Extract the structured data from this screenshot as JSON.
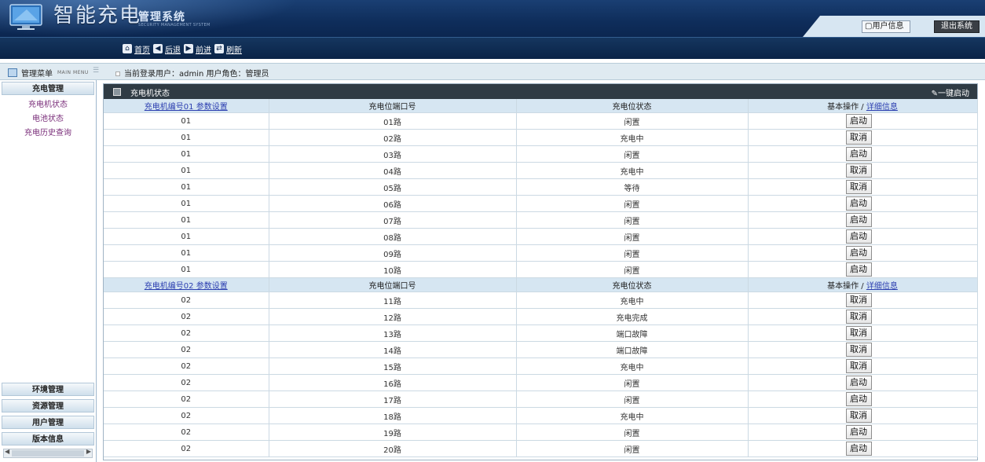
{
  "header": {
    "title": "智能充电",
    "subtitle": "管理系统",
    "subtitle_en": "SECURITY MANAGEMENT SYSTEM",
    "user_info_label": "用户信息",
    "logout_label": "退出系统"
  },
  "nav": {
    "home": "首页",
    "back": "后退",
    "forward": "前进",
    "refresh": "刷新"
  },
  "info_bar": {
    "menu_title": "管理菜单",
    "menu_title_en": "MAIN MENU",
    "login_text": "当前登录用户：admin  用户角色：管理员"
  },
  "sidebar": {
    "group_top": "充电管理",
    "items": [
      "充电机状态",
      "电池状态",
      "充电历史查询"
    ],
    "groups_bottom": [
      "环境管理",
      "资源管理",
      "用户管理",
      "版本信息"
    ]
  },
  "panel": {
    "title": "充电机状态",
    "one_click": "一键启动"
  },
  "table": {
    "col_port": "充电位端口号",
    "col_status": "充电位状态",
    "col_op_prefix": "基本操作 / ",
    "col_op_link": "详细信息",
    "groups": [
      {
        "header": "充电机编号01 参数设置",
        "rows": [
          {
            "machine": "01",
            "port": "01路",
            "status": "闲置",
            "action": "启动"
          },
          {
            "machine": "01",
            "port": "02路",
            "status": "充电中",
            "action": "取消"
          },
          {
            "machine": "01",
            "port": "03路",
            "status": "闲置",
            "action": "启动"
          },
          {
            "machine": "01",
            "port": "04路",
            "status": "充电中",
            "action": "取消"
          },
          {
            "machine": "01",
            "port": "05路",
            "status": "等待",
            "action": "取消"
          },
          {
            "machine": "01",
            "port": "06路",
            "status": "闲置",
            "action": "启动"
          },
          {
            "machine": "01",
            "port": "07路",
            "status": "闲置",
            "action": "启动"
          },
          {
            "machine": "01",
            "port": "08路",
            "status": "闲置",
            "action": "启动"
          },
          {
            "machine": "01",
            "port": "09路",
            "status": "闲置",
            "action": "启动"
          },
          {
            "machine": "01",
            "port": "10路",
            "status": "闲置",
            "action": "启动"
          }
        ]
      },
      {
        "header": "充电机编号02 参数设置",
        "rows": [
          {
            "machine": "02",
            "port": "11路",
            "status": "充电中",
            "action": "取消"
          },
          {
            "machine": "02",
            "port": "12路",
            "status": "充电完成",
            "action": "取消"
          },
          {
            "machine": "02",
            "port": "13路",
            "status": "端口故障",
            "action": "取消"
          },
          {
            "machine": "02",
            "port": "14路",
            "status": "端口故障",
            "action": "取消"
          },
          {
            "machine": "02",
            "port": "15路",
            "status": "充电中",
            "action": "取消"
          },
          {
            "machine": "02",
            "port": "16路",
            "status": "闲置",
            "action": "启动"
          },
          {
            "machine": "02",
            "port": "17路",
            "status": "闲置",
            "action": "启动"
          },
          {
            "machine": "02",
            "port": "18路",
            "status": "充电中",
            "action": "取消"
          },
          {
            "machine": "02",
            "port": "19路",
            "status": "闲置",
            "action": "启动"
          },
          {
            "machine": "02",
            "port": "20路",
            "status": "闲置",
            "action": "启动"
          }
        ]
      }
    ]
  }
}
